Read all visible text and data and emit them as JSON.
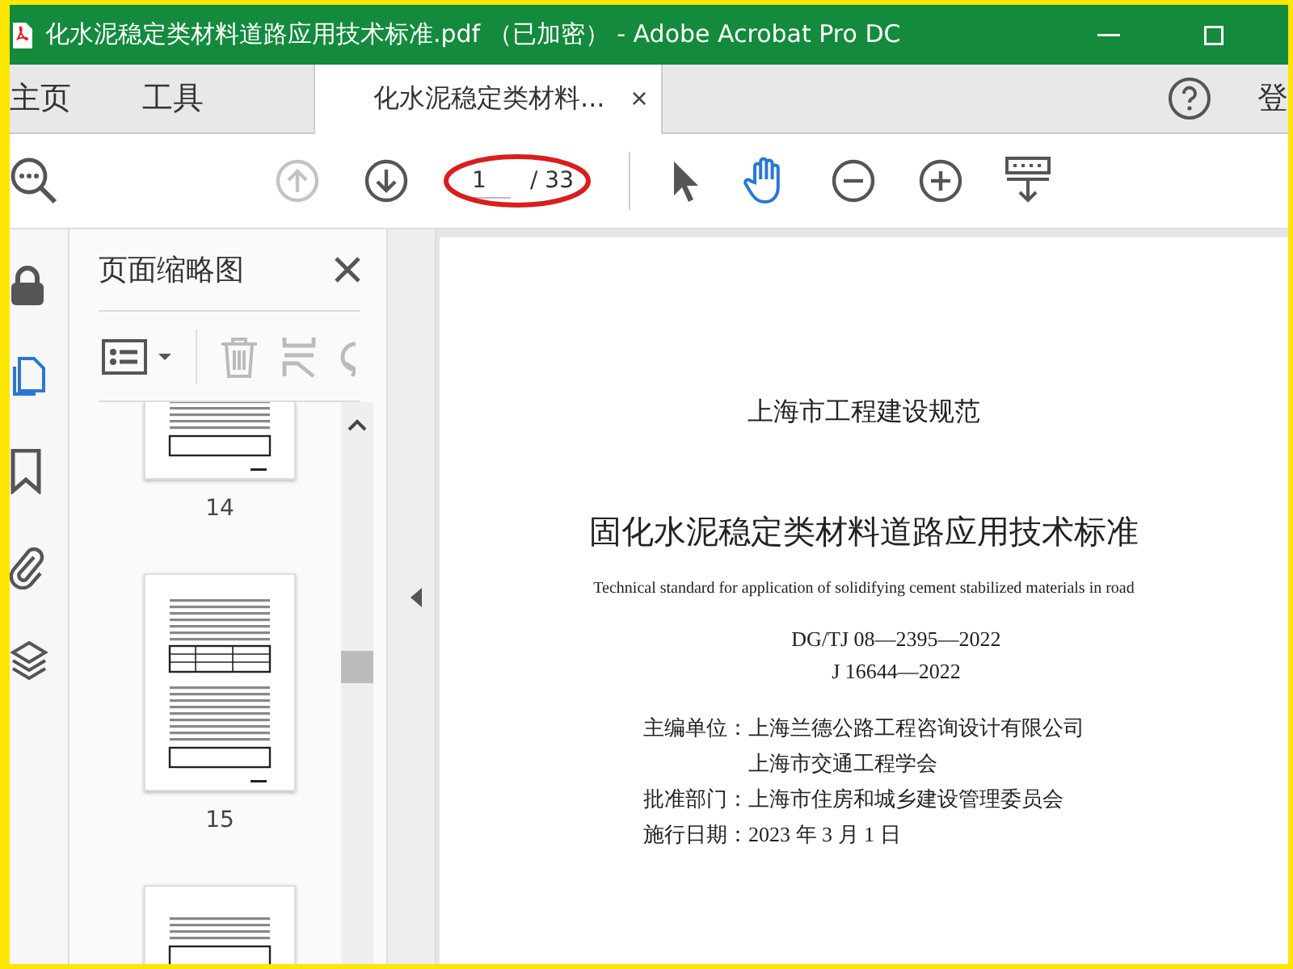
{
  "window": {
    "title": "化水泥稳定类材料道路应用技术标准.pdf （已加密） - Adobe Acrobat Pro DC"
  },
  "nav": [
    {
      "label": "主页",
      "selected": false
    },
    {
      "label": "工具",
      "selected": false
    }
  ],
  "document_tab": {
    "label": "化水泥稳定类材料...",
    "selected": true,
    "close": "×"
  },
  "sign_in": "登",
  "toolbar": {
    "nav_tools": [
      {
        "kind": "prev",
        "disabled": true
      },
      {
        "kind": "next",
        "disabled": false
      }
    ],
    "page_field": {
      "value": "1",
      "total": "/ 33"
    },
    "tools": [
      {
        "kind": "select",
        "selected": false
      },
      {
        "kind": "hand",
        "selected": true
      },
      {
        "kind": "zoom-out",
        "selected": false
      },
      {
        "kind": "zoom-in",
        "selected": false
      },
      {
        "kind": "read",
        "selected": false
      }
    ]
  },
  "rail": [
    {
      "kind": "lock",
      "selected": false
    },
    {
      "kind": "pages",
      "selected": true
    },
    {
      "kind": "bookmark",
      "selected": false
    },
    {
      "kind": "attach",
      "selected": false
    },
    {
      "kind": "layers",
      "selected": false
    }
  ],
  "panel": {
    "title": "页面缩略图",
    "thumbnails": [
      {
        "page": "14"
      },
      {
        "page": "15"
      }
    ]
  },
  "document": {
    "series": "上海市工程建设规范",
    "title": "固化水泥稳定类材料道路应用技术标准",
    "english_title": "Technical standard for application of solidifying cement stabilized materials in road",
    "codes": [
      "DG/TJ 08—2395—2022",
      "J 16644—2022"
    ],
    "credits": [
      {
        "label": "主编单位：",
        "values": [
          "上海兰德公路工程咨询设计有限公司",
          "上海市交通工程学会"
        ]
      },
      {
        "label": "批准部门：",
        "values": [
          "上海市住房和城乡建设管理委员会"
        ]
      },
      {
        "label": "施行日期：",
        "values": [
          "2023 年 3 月 1 日"
        ]
      }
    ]
  }
}
